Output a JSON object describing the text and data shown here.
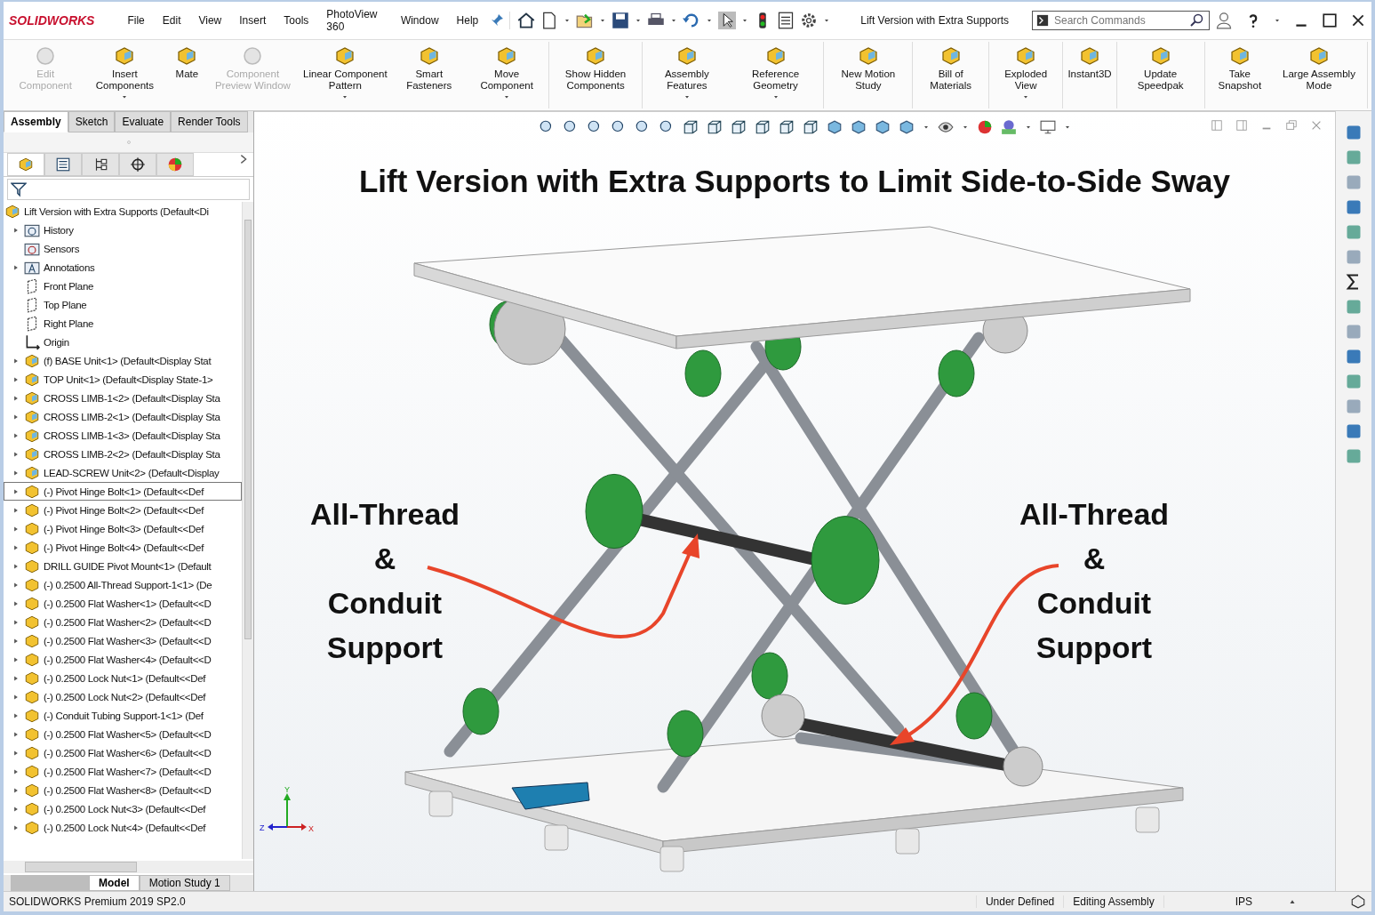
{
  "window": {
    "logo": "SOLIDWORKS",
    "title": "Lift Version with Extra Supports"
  },
  "menu": [
    "File",
    "Edit",
    "View",
    "Insert",
    "Tools",
    "PhotoView 360",
    "Window",
    "Help"
  ],
  "search": {
    "placeholder": "Search Commands"
  },
  "ribbon_groups": [
    [
      {
        "label": "Edit Component",
        "disabled": true,
        "dropdown": false
      },
      {
        "label": "Insert Components",
        "disabled": false,
        "dropdown": true
      },
      {
        "label": "Mate",
        "disabled": false,
        "dropdown": false
      },
      {
        "label": "Component Preview Window",
        "disabled": true,
        "dropdown": false
      },
      {
        "label": "Linear Component Pattern",
        "disabled": false,
        "dropdown": true
      },
      {
        "label": "Smart Fasteners",
        "disabled": false,
        "dropdown": false
      },
      {
        "label": "Move Component",
        "disabled": false,
        "dropdown": true
      }
    ],
    [
      {
        "label": "Show Hidden Components",
        "disabled": false,
        "dropdown": false
      }
    ],
    [
      {
        "label": "Assembly Features",
        "disabled": false,
        "dropdown": true
      },
      {
        "label": "Reference Geometry",
        "disabled": false,
        "dropdown": true
      }
    ],
    [
      {
        "label": "New Motion Study",
        "disabled": false,
        "dropdown": false
      }
    ],
    [
      {
        "label": "Bill of Materials",
        "disabled": false,
        "dropdown": false
      }
    ],
    [
      {
        "label": "Exploded View",
        "disabled": false,
        "dropdown": true
      }
    ],
    [
      {
        "label": "Instant3D",
        "disabled": false,
        "dropdown": false
      }
    ],
    [
      {
        "label": "Update Speedpak",
        "disabled": false,
        "dropdown": false
      }
    ],
    [
      {
        "label": "Take Snapshot",
        "disabled": false,
        "dropdown": false
      },
      {
        "label": "Large Assembly Mode",
        "disabled": false,
        "dropdown": false
      }
    ]
  ],
  "command_tabs": [
    {
      "label": "Assembly",
      "selected": true
    },
    {
      "label": "Sketch",
      "selected": false
    },
    {
      "label": "Evaluate",
      "selected": false
    },
    {
      "label": "Render Tools",
      "selected": false
    }
  ],
  "panel_tabs": [
    {
      "kind": "feature",
      "selected": true
    },
    {
      "kind": "property",
      "selected": false
    },
    {
      "kind": "configuration",
      "selected": false
    },
    {
      "kind": "dimxpert",
      "selected": false
    },
    {
      "kind": "display",
      "selected": false
    }
  ],
  "tree": {
    "label": "Lift Version with Extra Supports  (Default<Di",
    "kind": "assembly",
    "children": [
      {
        "label": "History",
        "kind": "history",
        "has_children": true,
        "selected": false
      },
      {
        "label": "Sensors",
        "kind": "sensors",
        "has_children": false,
        "selected": false
      },
      {
        "label": "Annotations",
        "kind": "annotations",
        "has_children": true,
        "selected": false
      },
      {
        "label": "Front Plane",
        "kind": "plane",
        "has_children": false,
        "selected": false
      },
      {
        "label": "Top Plane",
        "kind": "plane",
        "has_children": false,
        "selected": false
      },
      {
        "label": "Right Plane",
        "kind": "plane",
        "has_children": false,
        "selected": false
      },
      {
        "label": "Origin",
        "kind": "origin",
        "has_children": false,
        "selected": false
      },
      {
        "label": "(f) BASE Unit<1> (Default<Display Stat",
        "kind": "assembly",
        "has_children": true,
        "selected": false
      },
      {
        "label": "TOP Unit<1> (Default<Display State-1>",
        "kind": "assembly",
        "has_children": true,
        "selected": false
      },
      {
        "label": "CROSS LIMB-1<2> (Default<Display Sta",
        "kind": "assembly",
        "has_children": true,
        "selected": false
      },
      {
        "label": "CROSS LIMB-2<1> (Default<Display Sta",
        "kind": "assembly",
        "has_children": true,
        "selected": false
      },
      {
        "label": "CROSS LIMB-1<3> (Default<Display Sta",
        "kind": "assembly",
        "has_children": true,
        "selected": false
      },
      {
        "label": "CROSS LIMB-2<2> (Default<Display Sta",
        "kind": "assembly",
        "has_children": true,
        "selected": false
      },
      {
        "label": "LEAD-SCREW Unit<2> (Default<Display",
        "kind": "assembly",
        "has_children": true,
        "selected": false
      },
      {
        "label": "(-) Pivot Hinge Bolt<1> (Default<<Def",
        "kind": "part",
        "has_children": true,
        "selected": true
      },
      {
        "label": "(-) Pivot Hinge Bolt<2> (Default<<Def",
        "kind": "part",
        "has_children": true,
        "selected": false
      },
      {
        "label": "(-) Pivot Hinge Bolt<3> (Default<<Def",
        "kind": "part",
        "has_children": true,
        "selected": false
      },
      {
        "label": "(-) Pivot Hinge Bolt<4> (Default<<Def",
        "kind": "part",
        "has_children": true,
        "selected": false
      },
      {
        "label": "DRILL GUIDE Pivot Mount<1> (Default",
        "kind": "part",
        "has_children": true,
        "selected": false
      },
      {
        "label": "(-) 0.2500 All-Thread Support-1<1> (De",
        "kind": "part",
        "has_children": true,
        "selected": false
      },
      {
        "label": "(-) 0.2500 Flat Washer<1> (Default<<D",
        "kind": "part",
        "has_children": true,
        "selected": false
      },
      {
        "label": "(-) 0.2500 Flat Washer<2> (Default<<D",
        "kind": "part",
        "has_children": true,
        "selected": false
      },
      {
        "label": "(-) 0.2500 Flat Washer<3> (Default<<D",
        "kind": "part",
        "has_children": true,
        "selected": false
      },
      {
        "label": "(-) 0.2500 Flat Washer<4> (Default<<D",
        "kind": "part",
        "has_children": true,
        "selected": false
      },
      {
        "label": "(-) 0.2500 Lock Nut<1> (Default<<Def",
        "kind": "part",
        "has_children": true,
        "selected": false
      },
      {
        "label": "(-) 0.2500 Lock Nut<2> (Default<<Def",
        "kind": "part",
        "has_children": true,
        "selected": false
      },
      {
        "label": "(-) Conduit Tubing Support-1<1> (Def",
        "kind": "part",
        "has_children": true,
        "selected": false
      },
      {
        "label": "(-) 0.2500 Flat Washer<5> (Default<<D",
        "kind": "part",
        "has_children": true,
        "selected": false
      },
      {
        "label": "(-) 0.2500 Flat Washer<6> (Default<<D",
        "kind": "part",
        "has_children": true,
        "selected": false
      },
      {
        "label": "(-) 0.2500 Flat Washer<7> (Default<<D",
        "kind": "part",
        "has_children": true,
        "selected": false
      },
      {
        "label": "(-) 0.2500 Flat Washer<8> (Default<<D",
        "kind": "part",
        "has_children": true,
        "selected": false
      },
      {
        "label": "(-) 0.2500 Lock Nut<3> (Default<<Def",
        "kind": "part",
        "has_children": true,
        "selected": false
      },
      {
        "label": "(-) 0.2500 Lock Nut<4> (Default<<Def",
        "kind": "part",
        "has_children": true,
        "selected": false
      }
    ]
  },
  "bottom_tabs": [
    {
      "label": "Model",
      "selected": true
    },
    {
      "label": "Motion Study 1",
      "selected": false
    }
  ],
  "viewport": {
    "title": "Lift Version with Extra Supports to Limit Side-to-Side Sway",
    "callouts": [
      [
        "All-Thread",
        "&",
        "Conduit",
        "Support"
      ],
      [
        "All-Thread",
        "&",
        "Conduit",
        "Support"
      ]
    ],
    "axes": [
      "X",
      "Y",
      "Z"
    ]
  },
  "status_bar": {
    "product": "SOLIDWORKS Premium 2019 SP2.0",
    "state": "Under Defined",
    "mode": "Editing Assembly",
    "units": "IPS"
  }
}
